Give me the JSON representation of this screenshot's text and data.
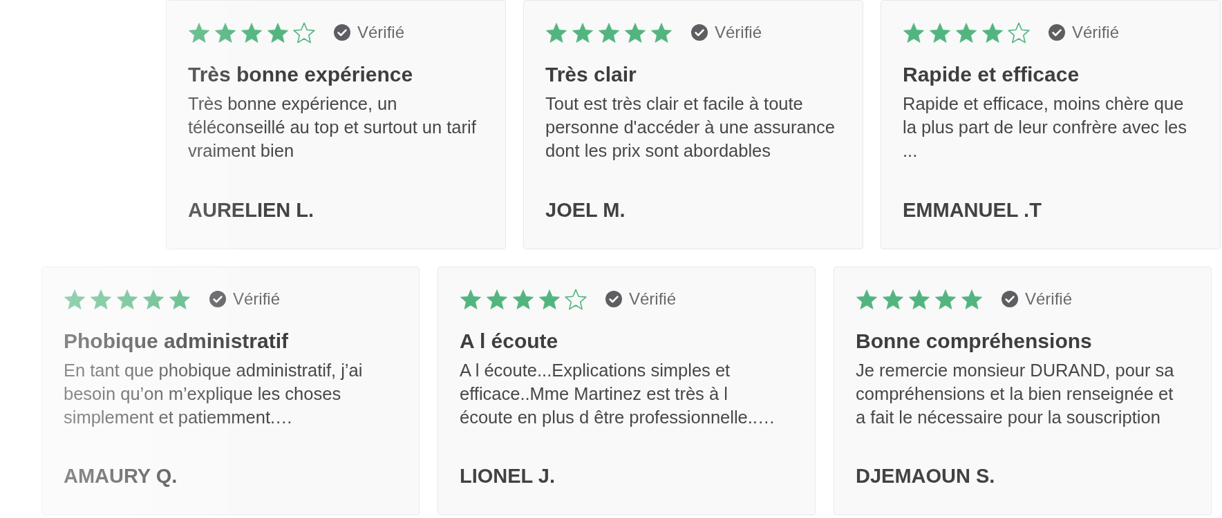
{
  "rows": [
    {
      "reviews": [
        {
          "stars": 4,
          "badge": "Vérifié",
          "title": "Très bonne expérience",
          "text": "Très bonne expérience, un téléconseillé au top et surtout un tarif vraiment bien",
          "author": "AURELIEN L."
        },
        {
          "stars": 5,
          "badge": "Vérifié",
          "title": "Très clair",
          "text": "Tout est très clair et facile à toute personne d'accéder à une assurance dont les prix sont abordables",
          "author": "JOEL M."
        },
        {
          "stars": 4,
          "badge": "Vérifié",
          "title": "Rapide et efficace",
          "text": "Rapide et efficace, moins chère que la plus part de leur confrère avec les ...",
          "author": "EMMANUEL .T"
        }
      ]
    },
    {
      "reviews": [
        {
          "stars": 5,
          "badge": "Vérifié",
          "title": "Phobique administratif",
          "text": "En tant que phobique administratif, j’ai besoin qu’on m’explique les choses simplement et patiemment.…",
          "author": "AMAURY Q."
        },
        {
          "stars": 4,
          "badge": "Vérifié",
          "title": "A l écoute",
          "text": "A l écoute...Explications simples et efficace..Mme Martinez est très à l écoute en plus d être professionnelle..…",
          "author": "LIONEL J."
        },
        {
          "stars": 5,
          "badge": "Vérifié",
          "title": "Bonne compréhensions",
          "text": "Je remercie monsieur DURAND, pour sa compréhensions et la bien renseignée et a fait le nécessaire pour la souscription",
          "author": "DJEMAOUN S."
        }
      ]
    }
  ]
}
